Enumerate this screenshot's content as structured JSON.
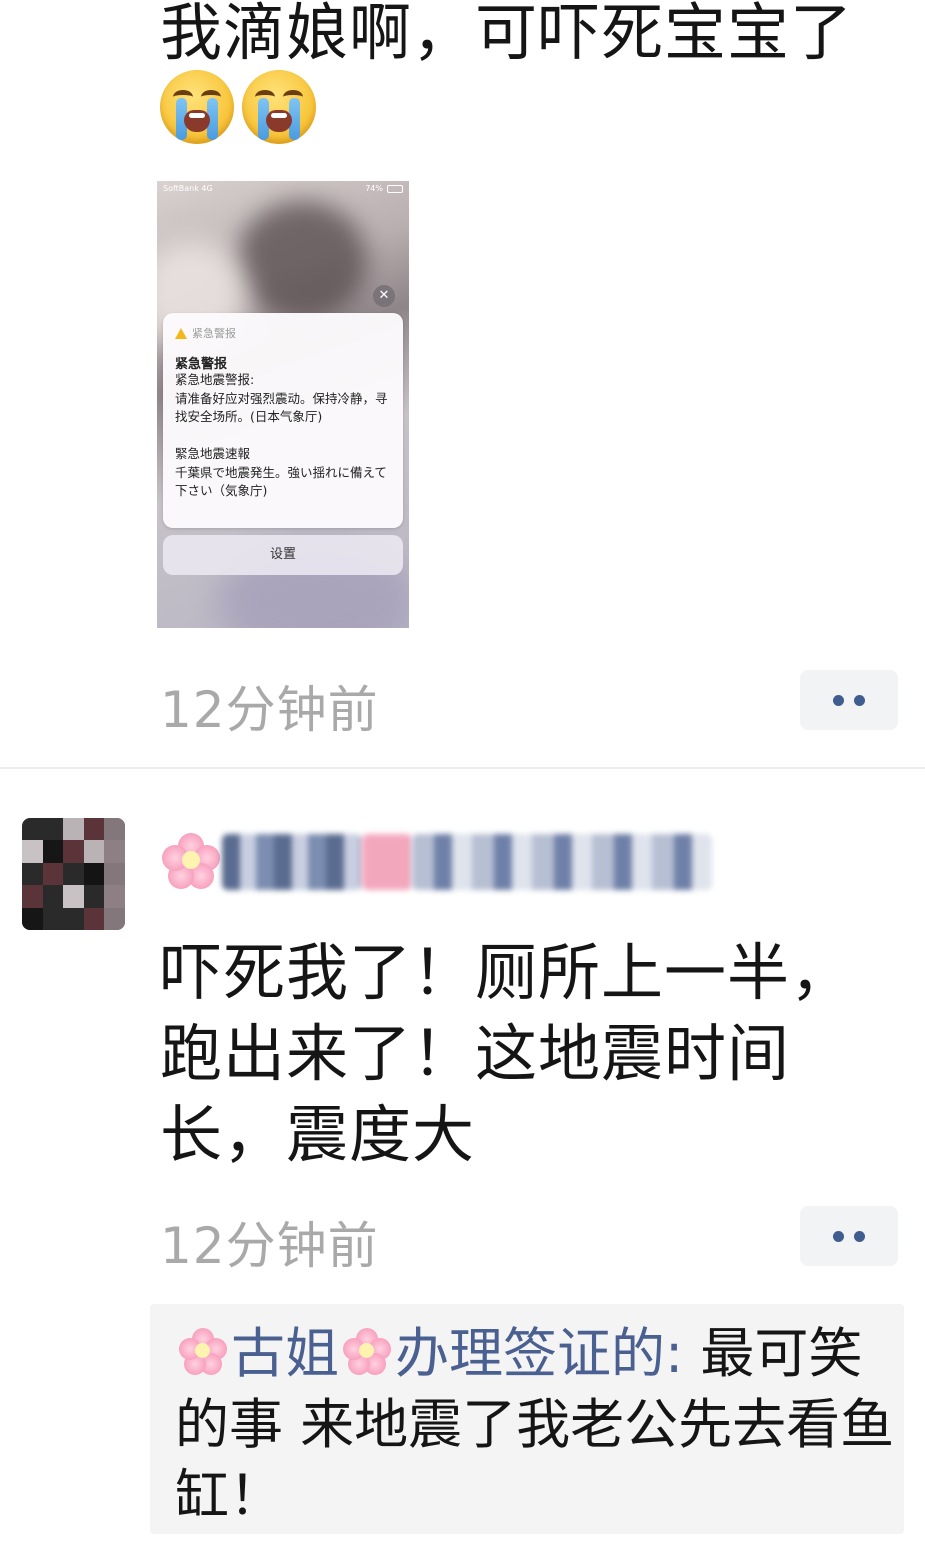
{
  "post1": {
    "text": "我滴娘啊，可吓死宝宝了",
    "emojis": [
      "loudly-crying-face",
      "loudly-crying-face"
    ],
    "screenshot": {
      "carrier": "SoftBank 4G",
      "battery": "74%",
      "alert_header": "紧急警报",
      "alert_title": "紧急警报",
      "alert_body": "紧急地震警报:\n请准备好应对强烈震动。保持冷静，寻找安全场所。(日本气象厅)\n\n緊急地震速報\n千葉県で地震発生。強い揺れに備えて下さい（気象庁)",
      "settings_button": "设置"
    },
    "time": "12分钟前"
  },
  "post2": {
    "text": "吓死我了！厕所上一半，跑出来了！这地震时间长，震度大",
    "time": "12分钟前"
  },
  "comment": {
    "name_part1": "古姐",
    "name_part2": "办理签证的",
    "text": "最可笑的事 来地震了我老公先去看鱼缸！"
  },
  "colors": {
    "name_blue": "#4a6090",
    "time_gray": "#a9a9a9",
    "more_dot": "#3f5d8e"
  }
}
